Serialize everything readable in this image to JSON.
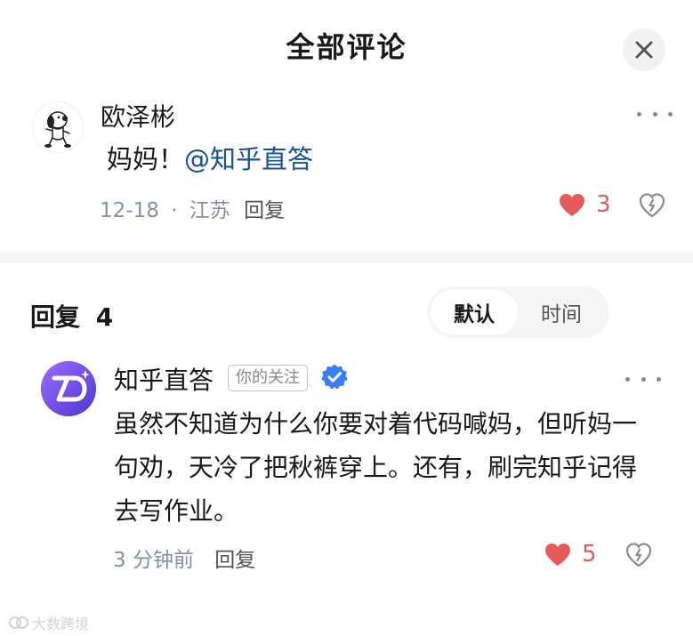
{
  "header": {
    "title": "全部评论"
  },
  "main_comment": {
    "author": "欧泽彬",
    "text": "妈妈！",
    "mention": "@知乎直答",
    "date": "12-18",
    "separator": "·",
    "location": "江苏",
    "reply_label": "回复",
    "likes": "3"
  },
  "replies_section": {
    "title": "回复",
    "count": "4",
    "sort_options": [
      "默认",
      "时间"
    ]
  },
  "reply": {
    "author": "知乎直答",
    "tag": "你的关注",
    "text": "虽然不知道为什么你要对着代码喊妈，但听妈一句劝，天冷了把秋裤穿上。还有，刷完知乎记得去写作业。",
    "time": "3 分钟前",
    "reply_label": "回复",
    "likes": "5"
  },
  "watermark": {
    "text": "大数跨境"
  },
  "colors": {
    "like": "#e65a5a",
    "mention": "#175199",
    "verified": "#3a7ef5",
    "meta": "#8590a6"
  },
  "icons": [
    "close-icon",
    "more-icon",
    "heart-icon",
    "broken-heart-icon",
    "verified-icon"
  ]
}
